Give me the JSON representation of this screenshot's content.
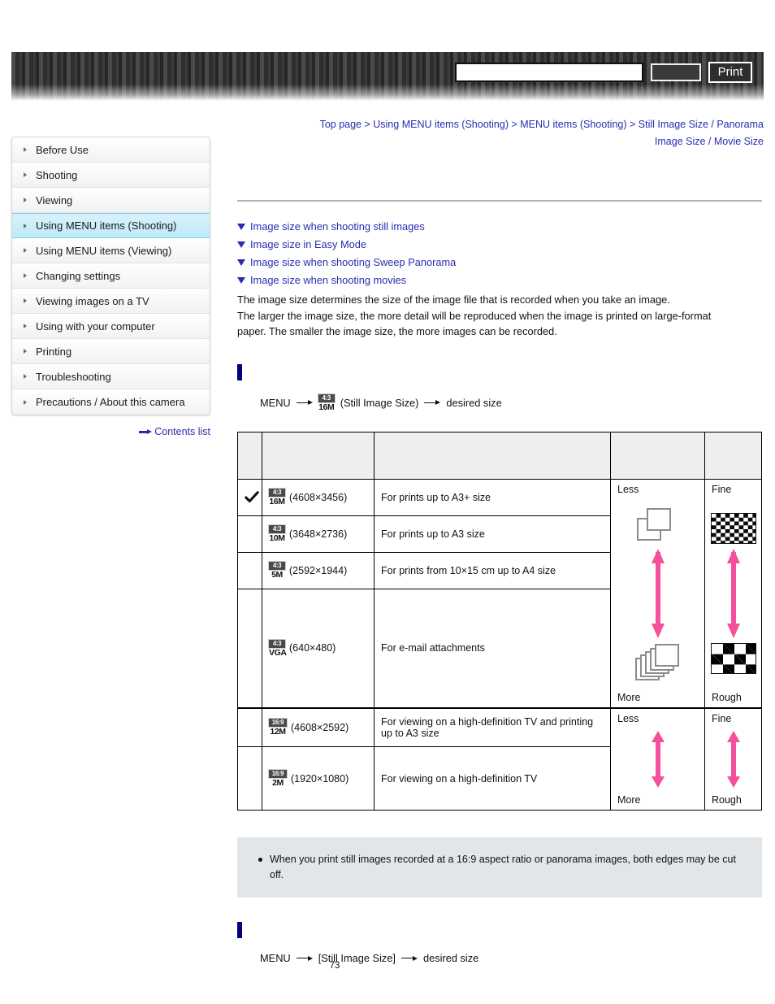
{
  "header": {
    "search_value": "",
    "search_placeholder": "",
    "search_button_label": "",
    "print_button_label": "Print"
  },
  "breadcrumb": {
    "items": [
      "Top page",
      "Using MENU items (Shooting)",
      "MENU items (Shooting)",
      "Still Image Size / Panorama Image Size / Movie Size"
    ],
    "separator": ">",
    "line1": "Top page > Using MENU items (Shooting) > MENU items (Shooting) > Still Image Size / Panorama",
    "line2": "Image Size / Movie Size"
  },
  "sidebar": {
    "items": [
      {
        "label": "Before Use",
        "active": false
      },
      {
        "label": "Shooting",
        "active": false
      },
      {
        "label": "Viewing",
        "active": false
      },
      {
        "label": "Using MENU items (Shooting)",
        "active": true
      },
      {
        "label": "Using MENU items (Viewing)",
        "active": false
      },
      {
        "label": "Changing settings",
        "active": false
      },
      {
        "label": "Viewing images on a TV",
        "active": false
      },
      {
        "label": "Using with your computer",
        "active": false
      },
      {
        "label": "Printing",
        "active": false
      },
      {
        "label": "Troubleshooting",
        "active": false
      },
      {
        "label": "Precautions / About this camera",
        "active": false
      }
    ],
    "contents_link": "Contents list"
  },
  "main": {
    "anchors": [
      "Image size when shooting still images",
      "Image size in Easy Mode",
      "Image size when shooting Sweep Panorama",
      "Image size when shooting movies"
    ],
    "intro_line1": "The image size determines the size of the image file that is recorded when you take an image.",
    "intro_line2": "The larger the image size, the more detail will be reproduced when the image is printed on large-format",
    "intro_line3": "paper. The smaller the image size, the more images can be recorded.",
    "section1": {
      "heading": "",
      "menu_label": "MENU",
      "badge_ratio": "4:3",
      "badge_cap": "16M",
      "menu_item": "(Still Image Size)",
      "menu_result": "desired size"
    },
    "section2": {
      "heading": "",
      "menu_label": "MENU",
      "menu_item": "[Still Image Size]",
      "menu_result": "desired size"
    },
    "table": {
      "headers": [
        "",
        "",
        "",
        "",
        ""
      ],
      "rows": [
        {
          "checked": true,
          "ratio": "4:3",
          "cap": "16M",
          "dims": "(4608×3456)",
          "desc": "For prints up to A3+ size"
        },
        {
          "checked": false,
          "ratio": "4:3",
          "cap": "10M",
          "dims": "(3648×2736)",
          "desc": "For prints up to A3 size"
        },
        {
          "checked": false,
          "ratio": "4:3",
          "cap": "5M",
          "dims": "(2592×1944)",
          "desc": "For prints from 10×15 cm up to A4 size"
        },
        {
          "checked": false,
          "ratio": "4:3",
          "cap": "VGA",
          "dims": "(640×480)",
          "desc": "For e-mail attachments"
        },
        {
          "checked": false,
          "ratio": "16:9",
          "cap": "12M",
          "dims": "(4608×2592)",
          "desc": "For viewing on a high-definition TV and printing up to A3 size"
        },
        {
          "checked": false,
          "ratio": "16:9",
          "cap": "2M",
          "dims": "(1920×1080)",
          "desc": "For viewing on a high-definition TV"
        }
      ],
      "gauges": {
        "images_top": "Less",
        "images_bottom": "More",
        "quality_top": "Fine",
        "quality_bottom": "Rough"
      }
    },
    "note": "When you print still images recorded at a 16:9 aspect ratio or panorama images, both edges may be cut off."
  },
  "page_number": "73",
  "colors": {
    "link": "#2b2bb0",
    "section_marker": "#000080",
    "arrow_pink": "#f5509b",
    "sidebar_active": "#bfeaf8",
    "note_bg": "#e2e6e9"
  }
}
